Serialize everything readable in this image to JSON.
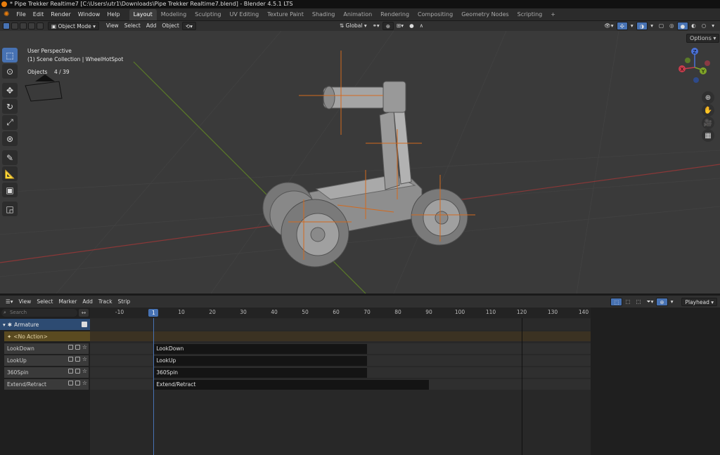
{
  "window": {
    "title": "* Pipe Trekker Realtime7 [C:\\Users\\utr1\\Downloads\\Pipe Trekker Realtime7.blend] - Blender 4.5.1 LTS"
  },
  "menubar": {
    "menus": [
      "File",
      "Edit",
      "Render",
      "Window",
      "Help"
    ],
    "workspaces": [
      "Layout",
      "Modeling",
      "Sculpting",
      "UV Editing",
      "Texture Paint",
      "Shading",
      "Animation",
      "Rendering",
      "Compositing",
      "Geometry Nodes",
      "Scripting"
    ],
    "active_workspace": "Layout",
    "add_tab": "+"
  },
  "viewport_header": {
    "mode": "Object Mode",
    "menus": [
      "View",
      "Select",
      "Add",
      "Object"
    ],
    "orientation": "Global",
    "options": "Options"
  },
  "viewport": {
    "perspective": "User Perspective",
    "collection": "(1) Scene Collection | WheelHotSpot",
    "objects_label": "Objects",
    "objects_count": "4 / 39",
    "gizmo_labels": {
      "z": "Z",
      "y": "Y",
      "x": "X"
    },
    "colors": {
      "background": "#3a3a3a",
      "x_axis": "#b03a3a",
      "y_axis": "#6a9a2a",
      "accent": "#4772b3"
    }
  },
  "nla_header": {
    "menus": [
      "View",
      "Select",
      "Marker",
      "Add",
      "Track",
      "Strip"
    ],
    "playhead": "Playhead"
  },
  "nla": {
    "search_placeholder": "Search",
    "armature": "Armature",
    "no_action": "<No Action>",
    "tracks": [
      "LookDown",
      "LookUp",
      "360Spin",
      "Extend/Retract"
    ],
    "current_frame": "1",
    "ruler": [
      "-10",
      "10",
      "20",
      "30",
      "40",
      "50",
      "60",
      "70",
      "80",
      "90",
      "100",
      "110",
      "120",
      "130",
      "140"
    ],
    "strips": [
      {
        "name": "LookDown",
        "start": 1,
        "end": 70
      },
      {
        "name": "LookUp",
        "start": 1,
        "end": 70
      },
      {
        "name": "360Spin",
        "start": 1,
        "end": 70
      },
      {
        "name": "Extend/Retract",
        "start": 1,
        "end": 90
      }
    ],
    "scene_end": 120
  }
}
